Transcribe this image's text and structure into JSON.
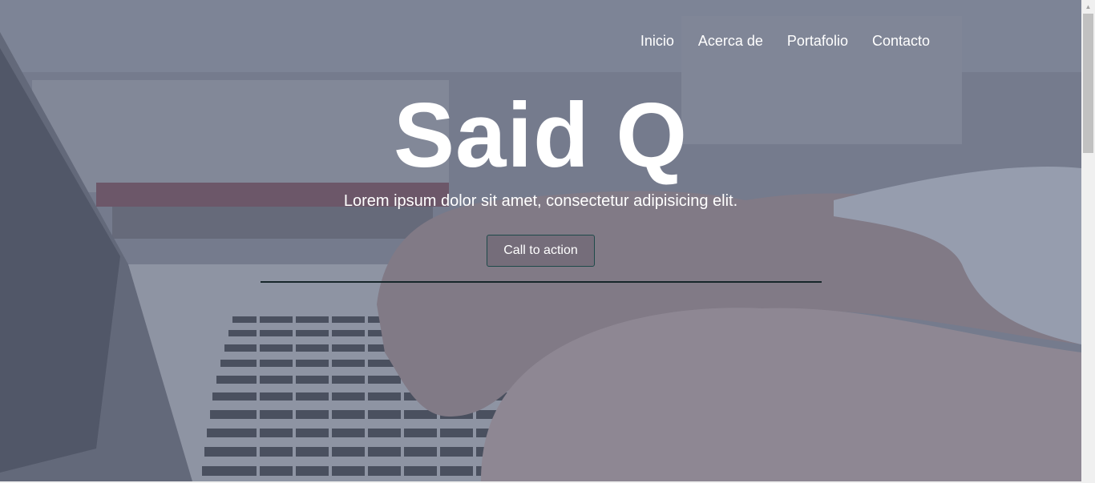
{
  "nav": {
    "items": [
      "Inicio",
      "Acerca de",
      "Portafolio",
      "Contacto"
    ]
  },
  "hero": {
    "title": "Said Q",
    "subtitle": "Lorem ipsum dolor sit amet, consectetur adipisicing elit.",
    "cta_label": "Call to action"
  },
  "colors": {
    "overlay": "#5c647d",
    "text": "#ffffff",
    "cta_border": "#1e4a4a",
    "divider": "#17262a"
  },
  "icons": {
    "scroll_up": "arrow-up-icon"
  }
}
